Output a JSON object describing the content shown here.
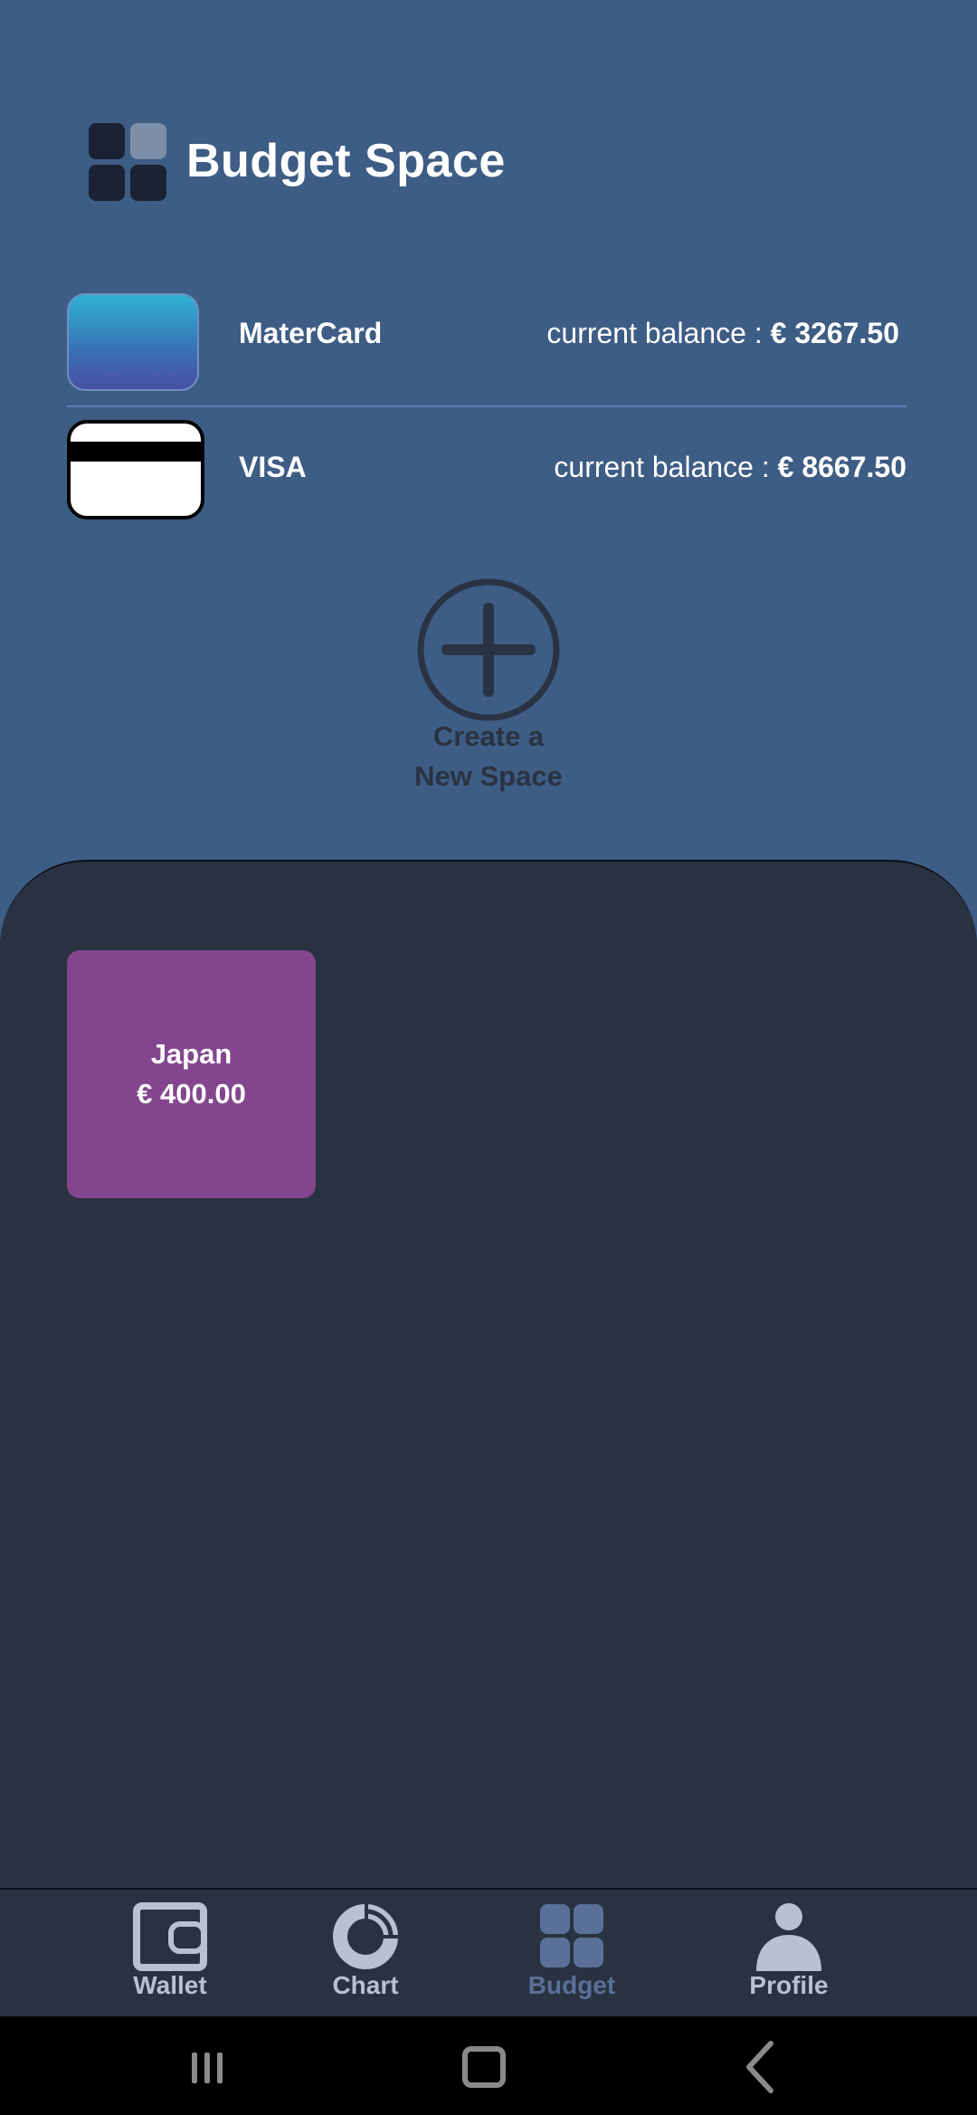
{
  "header": {
    "title": "Budget Space",
    "logo_icon": "grid-squares-icon"
  },
  "cards": [
    {
      "name": "MaterCard",
      "balance_label": "current balance : ",
      "balance_amount": "€ 3267.50",
      "icon": "credit-card-gradient-icon"
    },
    {
      "name": "VISA",
      "balance_label": "current balance : ",
      "balance_amount": "€ 8667.50",
      "icon": "credit-card-white-icon"
    }
  ],
  "create_space": {
    "line1": "Create a",
    "line2": "New Space",
    "icon": "plus-circle-icon"
  },
  "spaces": [
    {
      "name": "Japan",
      "amount": "€ 400.00",
      "color": "#83458e"
    }
  ],
  "bottom_nav": {
    "active": "Budget",
    "items": [
      {
        "label": "Wallet",
        "icon": "wallet-icon"
      },
      {
        "label": "Chart",
        "icon": "donut-chart-icon"
      },
      {
        "label": "Budget",
        "icon": "grid-squares-icon"
      },
      {
        "label": "Profile",
        "icon": "person-icon"
      }
    ]
  },
  "system_nav": {
    "buttons": [
      "recent-apps-icon",
      "home-icon",
      "back-icon"
    ]
  },
  "colors": {
    "background": "#3e5d85",
    "panel": "#293241",
    "accent_active": "#5a7098",
    "nav_inactive": "#b8c1cf",
    "space_tile": "#83458e"
  }
}
